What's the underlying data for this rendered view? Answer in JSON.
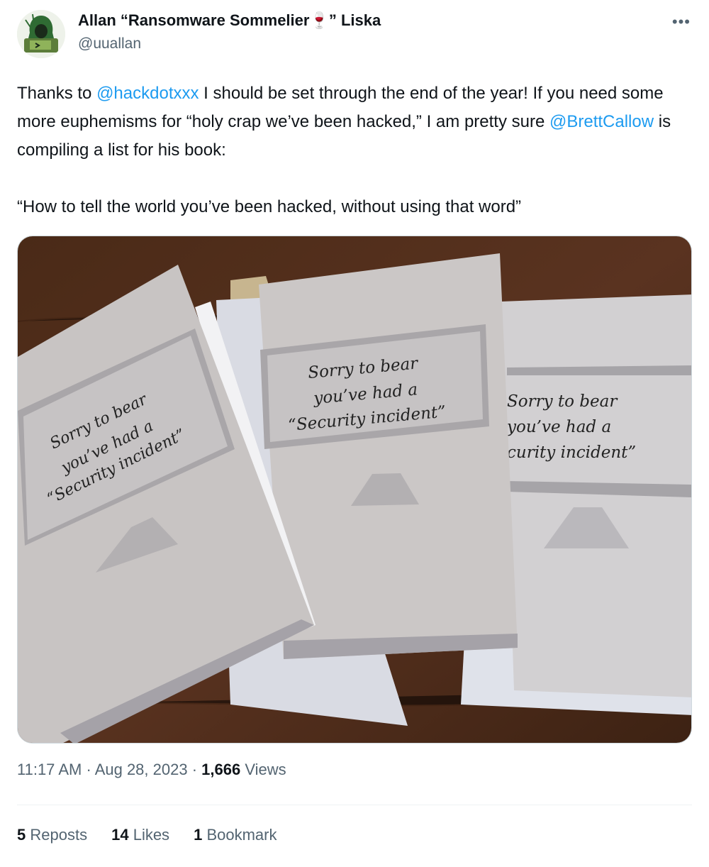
{
  "author": {
    "name": "Allan “Ransomware Sommelier🍷” Liska",
    "handle": "@uuallan",
    "avatar_icon": "hooded-figure-avatar",
    "more_icon": "more-options-icon"
  },
  "tweet": {
    "segments_line1": [
      {
        "text": "Thanks to ",
        "mention": false
      },
      {
        "text": "@hackdotxxx",
        "mention": true
      },
      {
        "text": " I should be set through the end of the year! If you need some more euphemisms for “holy crap we’ve been hacked,” I am pretty sure ",
        "mention": false
      },
      {
        "text": "@BrettCallow",
        "mention": true
      },
      {
        "text": " is compiling a list for his book:",
        "mention": false
      }
    ],
    "quote": "“How to tell the world you’ve been hacked, without using that word”"
  },
  "media": {
    "card_text_line1": "Sorry to bear",
    "card_text_line2": "you’ve had a",
    "card_text_line3": "“Security incident”",
    "card_right_line3": "curity incident”"
  },
  "meta": {
    "time": "11:17 AM",
    "date": "Aug 28, 2023",
    "views_count": "1,666",
    "views_label": "Views",
    "separator": "·"
  },
  "stats": {
    "reposts_count": "5",
    "reposts_label": "Reposts",
    "likes_count": "14",
    "likes_label": "Likes",
    "bookmarks_count": "1",
    "bookmarks_label": "Bookmark"
  },
  "colors": {
    "link": "#1d9bf0",
    "secondary_text": "#536471",
    "primary_text": "#0f1419"
  }
}
